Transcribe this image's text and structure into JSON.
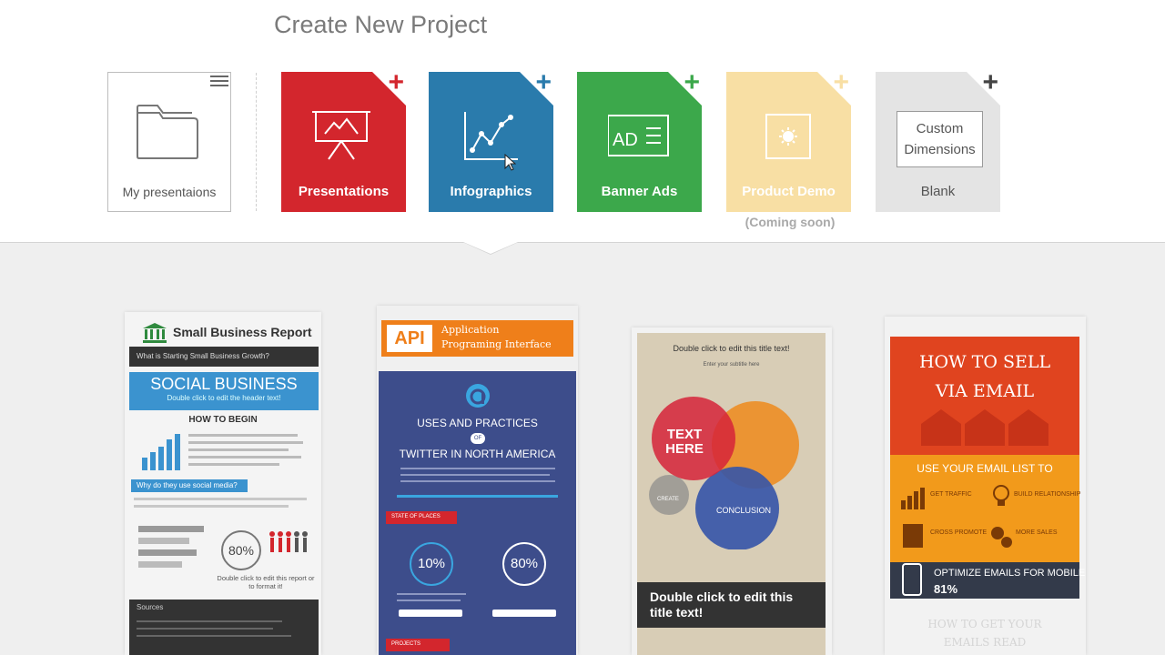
{
  "header": {
    "title": "Create New Project"
  },
  "tiles": {
    "my_presentations": {
      "label": "My presentaions"
    },
    "presentations": {
      "label": "Presentations",
      "color": "#d3262d"
    },
    "infographics": {
      "label": "Infographics",
      "color": "#2a7bac"
    },
    "banner_ads": {
      "label": "Banner Ads",
      "color": "#3ca84b",
      "icon_text": "AD"
    },
    "product_demo": {
      "label": "Product Demo",
      "color": "#f8dfa4",
      "note": "(Coming soon)"
    },
    "blank": {
      "label": "Blank",
      "color": "#e4e4e4",
      "inner_line1": "Custom",
      "inner_line2": "Dimensions"
    }
  },
  "templates": [
    {
      "name": "small-business",
      "title": "Small Business Report",
      "subtitle": "What is Starting Small Business Growth?",
      "heading": "SOCIAL BUSINESS",
      "heading_sub": "Double click to edit the header text!",
      "section": "HOW TO BEGIN",
      "bar_label": "Why do they use social media?",
      "stat": "80%",
      "stat_note": "Double click to edit this report or to format it!",
      "footer_label": "Sources"
    },
    {
      "name": "api",
      "badge": "API",
      "title_line1": "Application",
      "title_line2": "Programing Interface",
      "heading1": "USES AND PRACTICES",
      "of": "OF",
      "heading2": "TWITTER IN NORTH AMERICA",
      "ribbon": "STATE OF PLACES",
      "stat1": "10%",
      "stat2": "80%",
      "ribbon2": "PROJECTS"
    },
    {
      "name": "venn",
      "top_text": "Double click to edit this title text!",
      "sub_text": "Enter your subtitle here",
      "circle_text": "TEXT HERE",
      "small_label": "CREATE",
      "conclusion": "CONCLUSION",
      "bottom_text": "Double click to edit this title text!"
    },
    {
      "name": "email",
      "title": "HOW TO SELL VIA EMAIL",
      "band": "USE YOUR EMAIL LIST TO",
      "item1": "GET TRAFFIC",
      "item2": "BUILD RELATIONSHIP",
      "item3": "CROSS PROMOTE",
      "item4": "MORE SALES",
      "mobile_heading": "OPTIMIZE EMAILS FOR MOBILE",
      "mobile_stat": "81%",
      "faded_footer": "HOW TO GET YOUR EMAILS READ"
    }
  ]
}
